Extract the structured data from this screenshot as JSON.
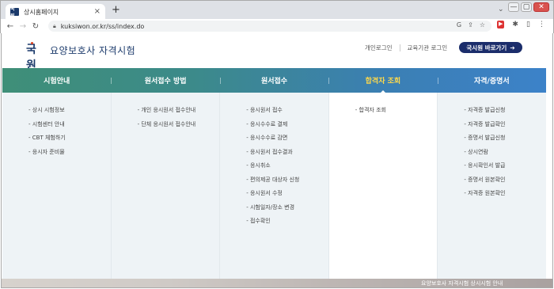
{
  "browser": {
    "tab_title": "상시홈페이지",
    "tab_favicon": "국원",
    "tab_close": "×",
    "new_tab": "+",
    "tab_dropdown": "⌄",
    "url": "kuksiwon.or.kr/ss/index.do",
    "nav": {
      "back": "←",
      "forward": "→",
      "reload": "↻"
    },
    "omni_icons": [
      "G",
      "⇪",
      "☆"
    ],
    "extensions": [
      "▶",
      "✱",
      "▯",
      "⋮"
    ],
    "window_controls": [
      "—",
      "▢",
      "✕"
    ]
  },
  "site": {
    "logo_mark": "국원",
    "site_name": "요양보호사 자격시험",
    "util_links": [
      "개인로그인",
      "교육기관 로그인"
    ],
    "shortcut_button": "국시원 바로가기",
    "shortcut_arrow": "➔",
    "accent_color": "#1b2d6b",
    "active_menu_color": "#ffd94a"
  },
  "nav": {
    "menus": [
      {
        "label": "시험안내",
        "items": [
          "상시 시험정보",
          "시험센터 안내",
          "CBT 체험하기",
          "응시자 준비물"
        ]
      },
      {
        "label": "원서접수 방법",
        "items": [
          "개인 응시원서 접수안내",
          "단체 응시원서 접수안내"
        ]
      },
      {
        "label": "원서접수",
        "items": [
          "응시원서 접수",
          "응시수수료 결제",
          "응시수수료 감면",
          "응시원서 접수결과",
          "응시취소",
          "편의제공 대상자 신청",
          "응시원서 수정",
          "시험일자/장소 변경",
          "접수확인"
        ]
      },
      {
        "label": "합격자 조회",
        "active": true,
        "items": [
          "합격자 조회"
        ]
      },
      {
        "label": "자격/증명서",
        "items": [
          "자격증 발급신청",
          "자격증 발급확인",
          "증명서 발급신청",
          "상시연람",
          "응시확인서 발급",
          "증명서 원본확인",
          "자격증 원본확인"
        ]
      }
    ]
  },
  "banner_text": "요양보호사 자격시험 상시시험 안내"
}
